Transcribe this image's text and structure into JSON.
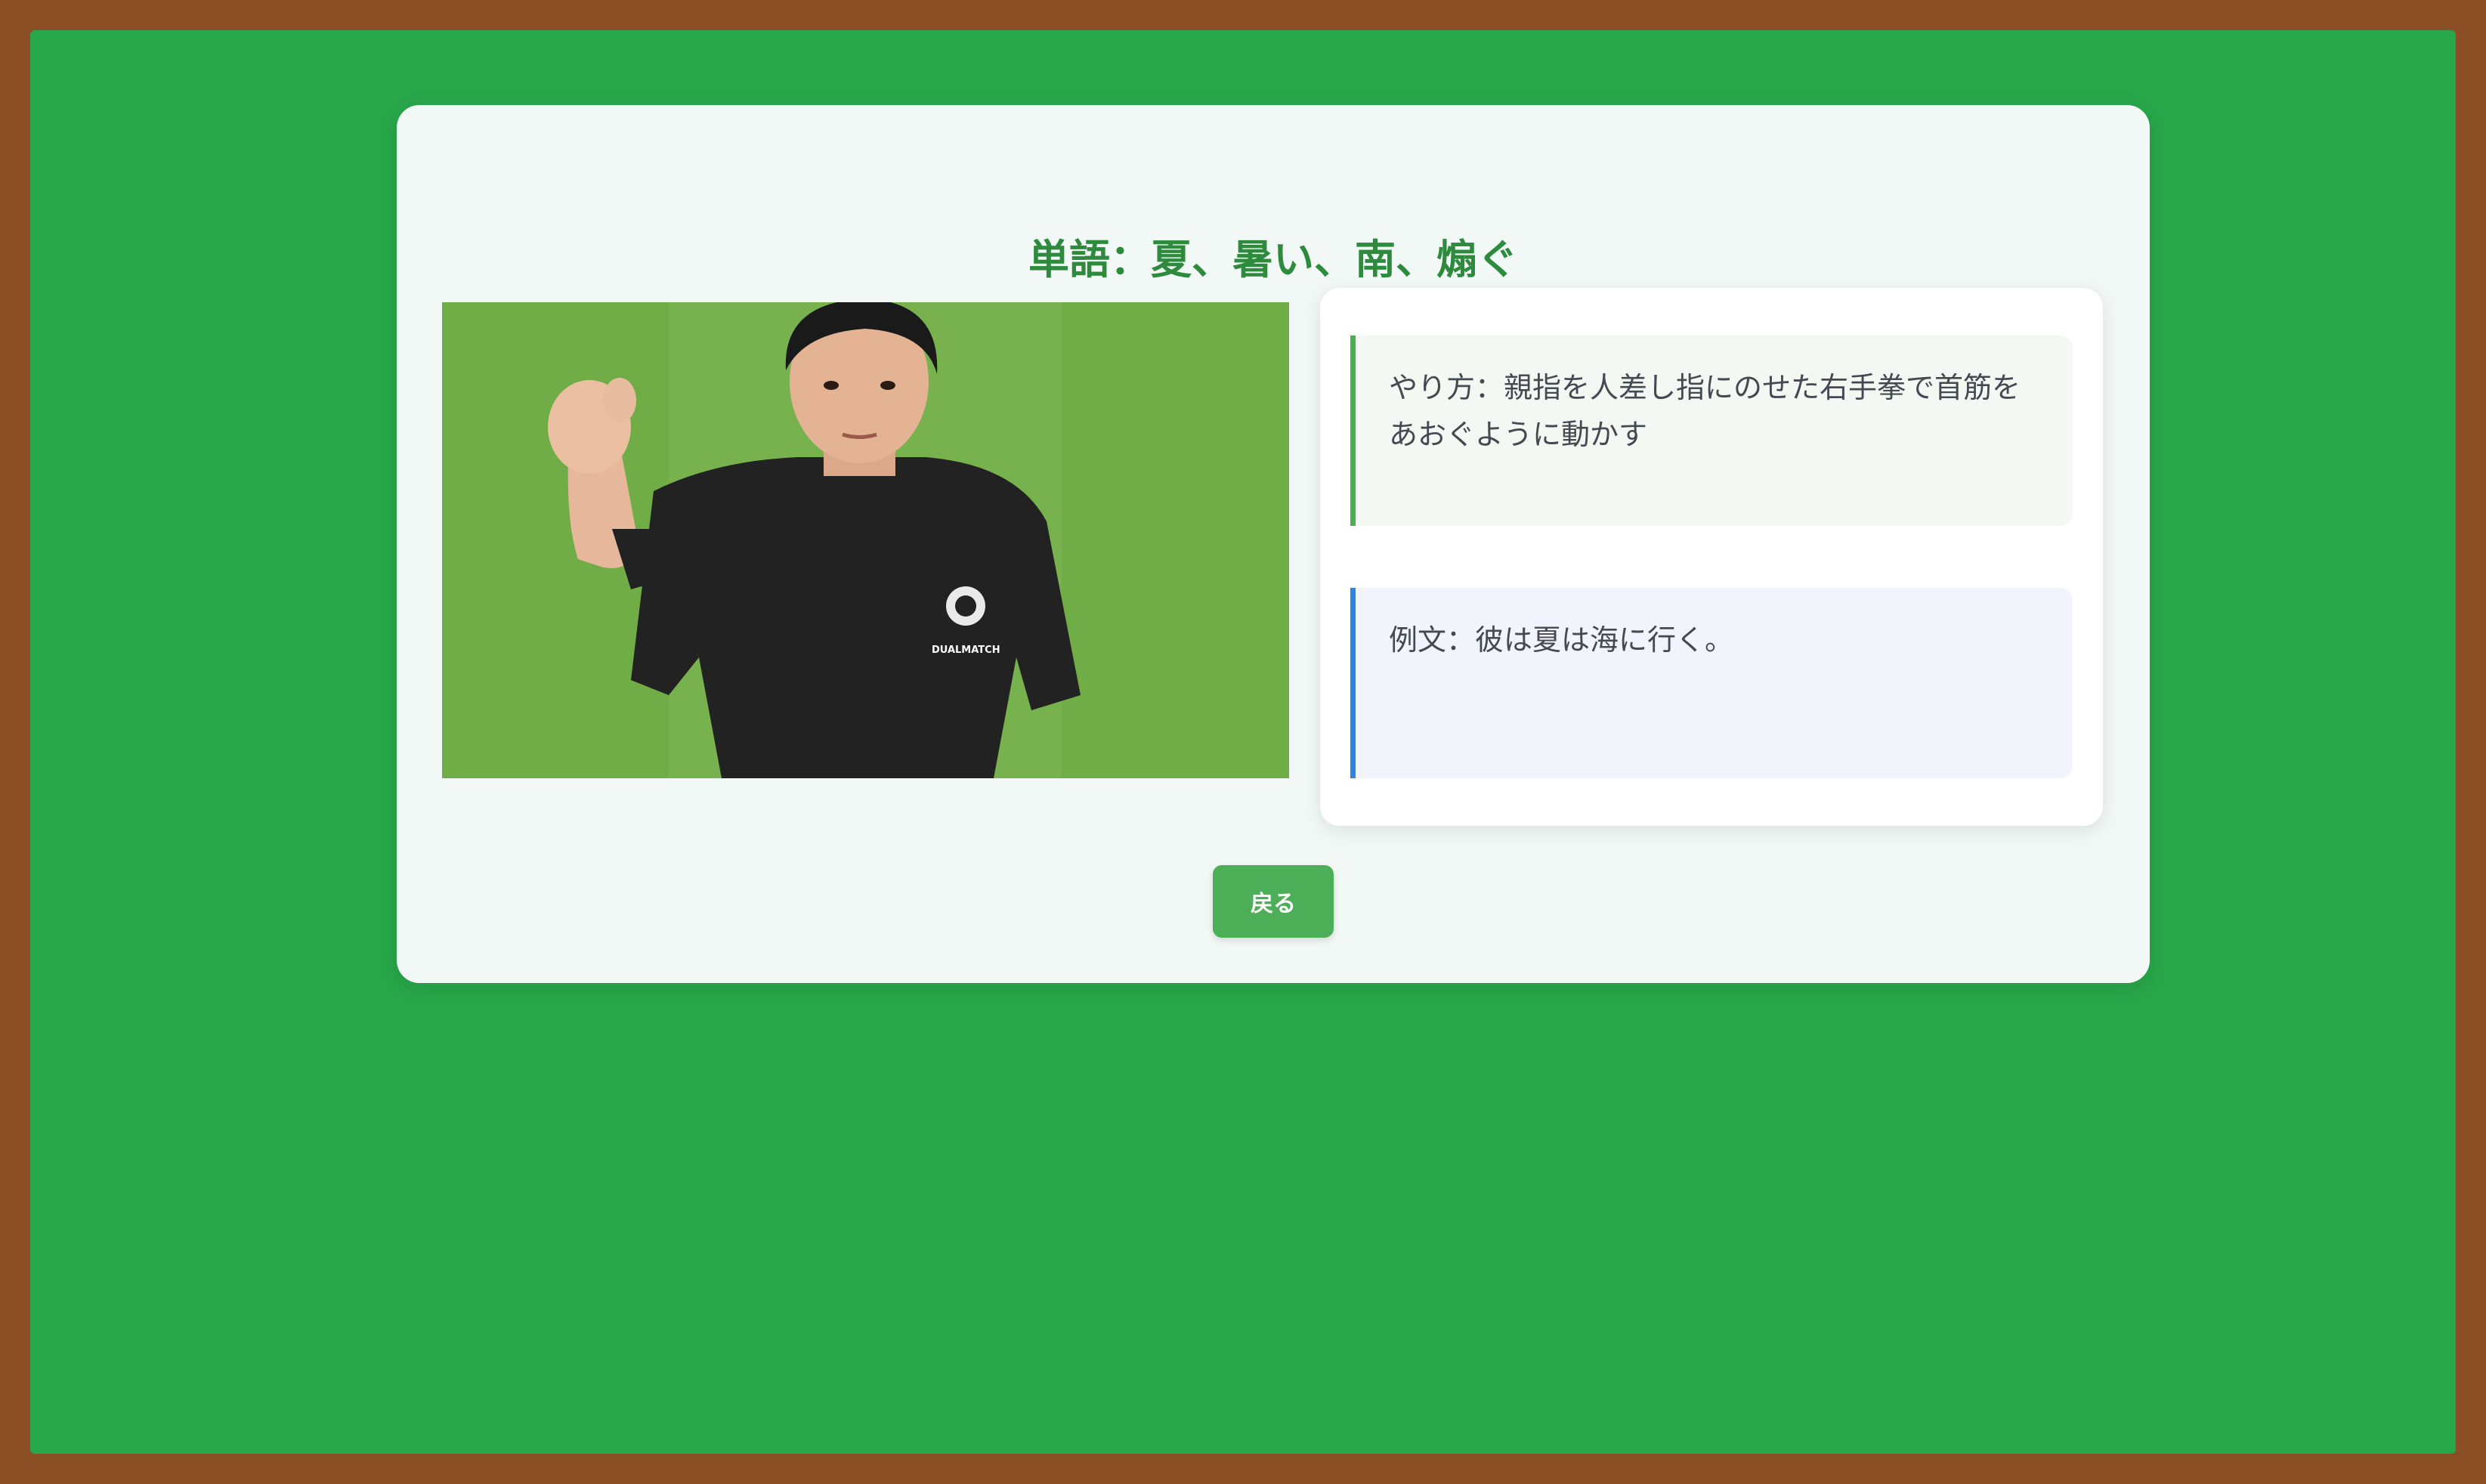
{
  "page": {
    "title": "単語：夏、暑い、南、煽ぐ"
  },
  "video": {
    "shirt_text": "DUALMATCH"
  },
  "details": {
    "method": "やり方：親指を人差し指にのせた右手拳で首筋をあおぐように動かす",
    "example": "例文：彼は夏は海に行く。"
  },
  "actions": {
    "back_label": "戻る"
  },
  "colors": {
    "frame": "#8b4f26",
    "board": "#28a64a",
    "title": "#2e8b3d",
    "method_accent": "#4caf50",
    "example_accent": "#2b86e0",
    "button": "#4cae56"
  }
}
